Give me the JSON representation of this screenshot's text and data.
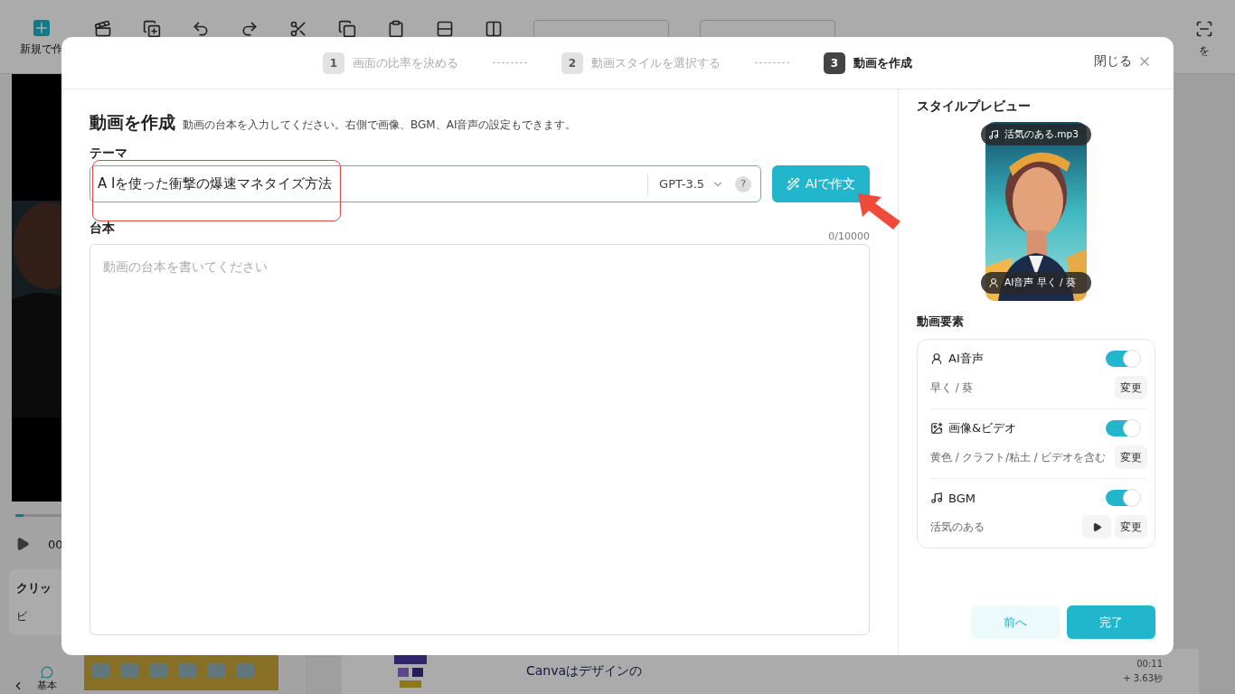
{
  "background_app": {
    "toolbar": {
      "new_label": "新規で作",
      "right_label": "を"
    },
    "player": {
      "time": "00",
      "level": 0.03
    },
    "clip_panel": {
      "title": "クリッ",
      "item": "ビ"
    },
    "bottom_tab": "基本",
    "clip_row": {
      "text": "Canvaはデザインの",
      "duration": "00:11",
      "added": "+ 3.63秒"
    }
  },
  "dialog": {
    "steps": [
      {
        "number": "1",
        "label": "画面の比率を決める",
        "selected": false
      },
      {
        "number": "2",
        "label": "動画スタイルを選択する",
        "selected": false
      },
      {
        "number": "3",
        "label": "動画を作成",
        "selected": true
      }
    ],
    "close_label": "閉じる",
    "title": "動画を作成",
    "subtitle": "動画の台本を入力してください。右側で画像、BGM、AI音声の設定もできます。",
    "theme": {
      "label": "テーマ",
      "value": "A Iを使った衝撃の爆速マネタイズ方法",
      "model": "GPT-3.5",
      "help": "?",
      "button": "AIで作文"
    },
    "script": {
      "label": "台本",
      "counter": "0/10000",
      "placeholder": "動画の台本を書いてください"
    },
    "preview": {
      "title": "スタイルプレビュー",
      "music_chip": "活気のある.mp3",
      "voice_chip": "AI音声  早く / 葵"
    },
    "elements_title": "動画要素",
    "elements": [
      {
        "kind": "voice",
        "title": "AI音声",
        "on": true,
        "detail": "早く / 葵",
        "change_label": "変更"
      },
      {
        "kind": "media",
        "title": "画像&ビデオ",
        "on": true,
        "detail": "黄色 / クラフト/粘土 / ビデオを含む",
        "change_label": "変更"
      },
      {
        "kind": "bgm",
        "title": "BGM",
        "on": true,
        "detail": "活気のある",
        "change_label": "変更"
      }
    ],
    "back_button": "前へ",
    "done_button": "完了"
  }
}
